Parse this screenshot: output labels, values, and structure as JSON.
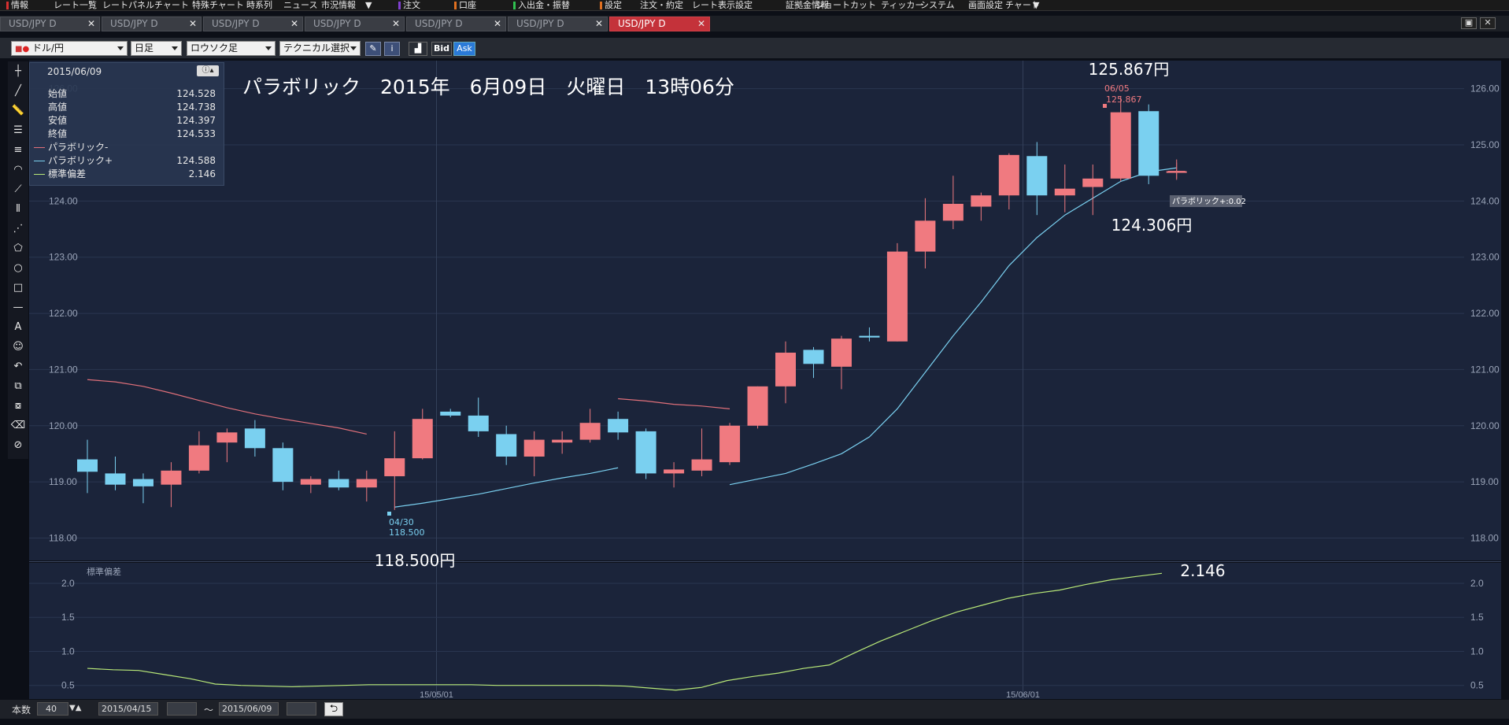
{
  "menu": [
    {
      "label": "情報",
      "color": "#d83030"
    },
    {
      "label": "レート一覧",
      "color": ""
    },
    {
      "label": "レートパネル",
      "color": ""
    },
    {
      "label": "チャート",
      "color": ""
    },
    {
      "label": "特殊チャート",
      "color": ""
    },
    {
      "label": "時系列",
      "color": ""
    },
    {
      "label": "ニュース",
      "color": ""
    },
    {
      "label": "市況情報",
      "color": ""
    },
    {
      "label": "▼",
      "color": ""
    },
    {
      "label": "注文",
      "color": "#8040d0"
    },
    {
      "label": "口座",
      "color": "#e07020"
    },
    {
      "label": "入出金・振替",
      "color": "#30c050"
    },
    {
      "label": "設定",
      "color": "#e07020"
    },
    {
      "label": "注文・約定",
      "color": ""
    },
    {
      "label": "レート表示設定",
      "color": ""
    },
    {
      "label": "証拠金情報",
      "color": ""
    },
    {
      "label": "ショートカット",
      "color": ""
    },
    {
      "label": "ティッカー",
      "color": ""
    },
    {
      "label": "システム",
      "color": ""
    },
    {
      "label": "画面設定",
      "color": ""
    },
    {
      "label": "チャート",
      "color": ""
    },
    {
      "label": "▼",
      "color": ""
    }
  ],
  "tabs": [
    {
      "label": "USD/JPY D",
      "active": false
    },
    {
      "label": "USD/JPY D",
      "active": false
    },
    {
      "label": "USD/JPY D",
      "active": false
    },
    {
      "label": "USD/JPY D",
      "active": false
    },
    {
      "label": "USD/JPY D",
      "active": false
    },
    {
      "label": "USD/JPY D",
      "active": false
    },
    {
      "label": "USD/JPY D",
      "active": true
    }
  ],
  "toolbar": {
    "pair": "ドル/円",
    "timeframe": "日足",
    "chart_style": "ロウソク足",
    "technical": "テクニカル選択",
    "bid": "Bid",
    "ask": "Ask"
  },
  "info_panel": {
    "date": "2015/06/09",
    "rows": [
      {
        "label": "始値",
        "value": "124.528"
      },
      {
        "label": "高値",
        "value": "124.738"
      },
      {
        "label": "安値",
        "value": "124.397"
      },
      {
        "label": "終値",
        "value": "124.533"
      },
      {
        "label": "パラボリック-",
        "value": "",
        "color": "#e0707a"
      },
      {
        "label": "パラボリック+",
        "value": "124.588",
        "color": "#7ad0f0"
      },
      {
        "label": "標準偏差",
        "value": "2.146",
        "color": "#b8e878"
      }
    ]
  },
  "annotations": {
    "title": "パラボリック　2015年　6月09日　火曜日　13時06分",
    "high_big": "125.867円",
    "high_date": "06/05",
    "high_val": "125.867",
    "low_big": "118.500円",
    "low_date": "04/30",
    "low_val": "118.500",
    "psar_big": "124.306円",
    "psar_tag": "パラボリック+:0.02",
    "sd_big": "2.146",
    "sd_label": "標準偏差"
  },
  "bottom": {
    "count_label": "本数",
    "count": "40",
    "from": "2015/04/15",
    "tilde": "～",
    "to": "2015/06/09"
  },
  "colors": {
    "up": "#f07a80",
    "down": "#7ad0f0",
    "grid": "#2a3650",
    "sd": "#b8e878"
  },
  "chart_data": {
    "type": "candlestick",
    "ylim": [
      117.6,
      126.5
    ],
    "yticks": [
      "118.00",
      "119.00",
      "120.00",
      "121.00",
      "122.00",
      "123.00",
      "124.00",
      "125.00",
      "126.00"
    ],
    "x_ticks": [
      {
        "label": "15/05/01",
        "index": 12.5
      },
      {
        "label": "15/06/01",
        "index": 33.5
      }
    ],
    "candles": [
      {
        "o": 119.4,
        "h": 119.75,
        "l": 118.8,
        "c": 119.18
      },
      {
        "o": 119.15,
        "h": 119.45,
        "l": 118.85,
        "c": 118.95
      },
      {
        "o": 119.05,
        "h": 119.15,
        "l": 118.62,
        "c": 118.92
      },
      {
        "o": 118.95,
        "h": 119.35,
        "l": 118.55,
        "c": 119.2
      },
      {
        "o": 119.2,
        "h": 119.9,
        "l": 119.15,
        "c": 119.65
      },
      {
        "o": 119.7,
        "h": 119.95,
        "l": 119.35,
        "c": 119.88
      },
      {
        "o": 119.95,
        "h": 120.1,
        "l": 119.45,
        "c": 119.6
      },
      {
        "o": 119.6,
        "h": 119.7,
        "l": 118.85,
        "c": 119.0
      },
      {
        "o": 118.95,
        "h": 119.1,
        "l": 118.8,
        "c": 119.05
      },
      {
        "o": 119.05,
        "h": 119.2,
        "l": 118.85,
        "c": 118.9
      },
      {
        "o": 118.9,
        "h": 119.2,
        "l": 118.65,
        "c": 119.05
      },
      {
        "o": 119.1,
        "h": 119.9,
        "l": 118.5,
        "c": 119.42
      },
      {
        "o": 119.42,
        "h": 120.3,
        "l": 119.4,
        "c": 120.12
      },
      {
        "o": 120.25,
        "h": 120.3,
        "l": 120.15,
        "c": 120.18
      },
      {
        "o": 120.18,
        "h": 120.5,
        "l": 119.8,
        "c": 119.9
      },
      {
        "o": 119.85,
        "h": 120.0,
        "l": 119.3,
        "c": 119.45
      },
      {
        "o": 119.45,
        "h": 119.9,
        "l": 119.1,
        "c": 119.75
      },
      {
        "o": 119.7,
        "h": 119.9,
        "l": 119.5,
        "c": 119.75
      },
      {
        "o": 119.75,
        "h": 120.3,
        "l": 119.7,
        "c": 120.05
      },
      {
        "o": 120.12,
        "h": 120.25,
        "l": 119.75,
        "c": 119.88
      },
      {
        "o": 119.9,
        "h": 119.95,
        "l": 119.05,
        "c": 119.15
      },
      {
        "o": 119.15,
        "h": 119.35,
        "l": 118.9,
        "c": 119.22
      },
      {
        "o": 119.2,
        "h": 119.95,
        "l": 119.1,
        "c": 119.4
      },
      {
        "o": 119.35,
        "h": 120.05,
        "l": 119.3,
        "c": 120.0
      },
      {
        "o": 120.0,
        "h": 120.7,
        "l": 119.95,
        "c": 120.7
      },
      {
        "o": 120.7,
        "h": 121.5,
        "l": 120.4,
        "c": 121.3
      },
      {
        "o": 121.35,
        "h": 121.4,
        "l": 120.85,
        "c": 121.1
      },
      {
        "o": 121.05,
        "h": 121.6,
        "l": 120.65,
        "c": 121.55
      },
      {
        "o": 121.6,
        "h": 121.75,
        "l": 121.5,
        "c": 121.57
      },
      {
        "o": 121.5,
        "h": 123.25,
        "l": 121.5,
        "c": 123.1
      },
      {
        "o": 123.1,
        "h": 124.05,
        "l": 122.8,
        "c": 123.65
      },
      {
        "o": 123.65,
        "h": 124.45,
        "l": 123.5,
        "c": 123.95
      },
      {
        "o": 123.9,
        "h": 124.15,
        "l": 123.65,
        "c": 124.1
      },
      {
        "o": 124.1,
        "h": 124.85,
        "l": 123.85,
        "c": 124.82
      },
      {
        "o": 124.8,
        "h": 125.05,
        "l": 123.75,
        "c": 124.1
      },
      {
        "o": 124.1,
        "h": 124.65,
        "l": 123.8,
        "c": 124.22
      },
      {
        "o": 124.25,
        "h": 124.65,
        "l": 123.75,
        "c": 124.4
      },
      {
        "o": 124.4,
        "h": 125.87,
        "l": 124.35,
        "c": 125.58
      },
      {
        "o": 125.6,
        "h": 125.72,
        "l": 124.3,
        "c": 124.45
      },
      {
        "o": 124.53,
        "h": 124.74,
        "l": 124.4,
        "c": 124.53
      }
    ],
    "psar_minus": [
      {
        "i": 0,
        "v": 120.82
      },
      {
        "i": 1,
        "v": 120.78
      },
      {
        "i": 2,
        "v": 120.7
      },
      {
        "i": 3,
        "v": 120.58
      },
      {
        "i": 4,
        "v": 120.45
      },
      {
        "i": 5,
        "v": 120.32
      },
      {
        "i": 6,
        "v": 120.21
      },
      {
        "i": 7,
        "v": 120.12
      },
      {
        "i": 8,
        "v": 120.04
      },
      {
        "i": 9,
        "v": 119.96
      },
      {
        "i": 10,
        "v": 119.85
      }
    ],
    "psar_minus2": [
      {
        "i": 19,
        "v": 120.48
      },
      {
        "i": 20,
        "v": 120.44
      },
      {
        "i": 21,
        "v": 120.38
      },
      {
        "i": 22,
        "v": 120.35
      },
      {
        "i": 23,
        "v": 120.3
      }
    ],
    "psar_plus": [
      {
        "i": 11,
        "v": 118.55
      },
      {
        "i": 12,
        "v": 118.62
      },
      {
        "i": 13,
        "v": 118.7
      },
      {
        "i": 14,
        "v": 118.78
      },
      {
        "i": 15,
        "v": 118.88
      },
      {
        "i": 16,
        "v": 118.98
      },
      {
        "i": 17,
        "v": 119.07
      },
      {
        "i": 18,
        "v": 119.15
      },
      {
        "i": 19,
        "v": 119.25
      }
    ],
    "psar_plus2": [
      {
        "i": 23,
        "v": 118.95
      },
      {
        "i": 24,
        "v": 119.05
      },
      {
        "i": 25,
        "v": 119.15
      },
      {
        "i": 26,
        "v": 119.32
      },
      {
        "i": 27,
        "v": 119.5
      },
      {
        "i": 28,
        "v": 119.8
      },
      {
        "i": 29,
        "v": 120.3
      },
      {
        "i": 30,
        "v": 120.95
      },
      {
        "i": 31,
        "v": 121.6
      },
      {
        "i": 32,
        "v": 122.2
      },
      {
        "i": 33,
        "v": 122.85
      },
      {
        "i": 34,
        "v": 123.35
      },
      {
        "i": 35,
        "v": 123.75
      },
      {
        "i": 36,
        "v": 124.05
      },
      {
        "i": 37,
        "v": 124.35
      },
      {
        "i": 38,
        "v": 124.52
      },
      {
        "i": 39,
        "v": 124.59
      }
    ],
    "sd_ylim": [
      0.3,
      2.3
    ],
    "sd_yticks": [
      "0.5",
      "1.0",
      "1.5",
      "2.0"
    ],
    "sd": [
      0.75,
      0.73,
      0.72,
      0.66,
      0.6,
      0.52,
      0.5,
      0.49,
      0.48,
      0.49,
      0.5,
      0.51,
      0.51,
      0.51,
      0.51,
      0.51,
      0.5,
      0.5,
      0.5,
      0.5,
      0.5,
      0.49,
      0.46,
      0.43,
      0.47,
      0.57,
      0.63,
      0.68,
      0.75,
      0.8,
      0.98,
      1.15,
      1.3,
      1.45,
      1.58,
      1.68,
      1.78,
      1.85,
      1.9,
      1.98,
      2.05,
      2.1,
      2.146
    ]
  }
}
